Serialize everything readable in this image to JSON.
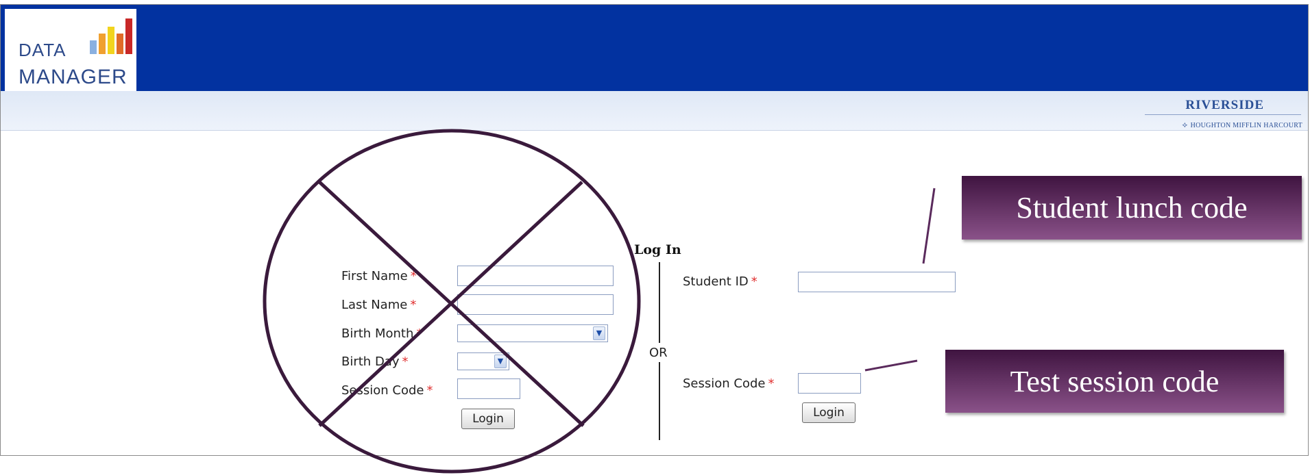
{
  "header": {
    "logo_line1": "DATA",
    "logo_line2": "MANAGER",
    "riverside": "RIVERSIDE",
    "publisher": "HOUGHTON MIFFLIN HARCOURT"
  },
  "login": {
    "title": "Log In",
    "or_label": "OR",
    "left_form": {
      "first_name_label": "First Name",
      "last_name_label": "Last Name",
      "birth_month_label": "Birth Month",
      "birth_day_label": "Birth Day",
      "session_code_label": "Session Code",
      "required_mark": "*",
      "login_button": "Login"
    },
    "right_form": {
      "student_id_label": "Student ID",
      "session_code_label": "Session Code",
      "required_mark": "*",
      "login_button": "Login"
    }
  },
  "annotations": {
    "student_callout": "Student lunch code",
    "session_callout": "Test session code"
  },
  "colors": {
    "header_blue": "#0232a0",
    "callout_purple": "#5a2a5c",
    "cross_color": "#3a1a3c"
  },
  "icons": [
    "chevron-down-icon",
    "hmh-bird-icon"
  ]
}
